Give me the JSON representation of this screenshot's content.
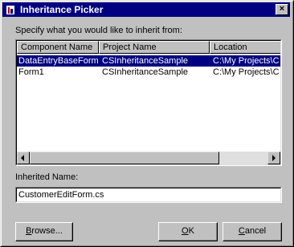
{
  "window": {
    "title": "Inheritance Picker",
    "close_glyph": "×",
    "icon": "app-icon"
  },
  "instruction": "Specify what you would like to inherit from:",
  "list": {
    "columns": [
      "Component Name",
      "Project Name",
      "Location"
    ],
    "rows": [
      {
        "component": "DataEntryBaseForm",
        "project": "CSInheritanceSample",
        "location": "C:\\My Projects\\C",
        "selected": true
      },
      {
        "component": "Form1",
        "project": "CSInheritanceSample",
        "location": "C:\\My Projects\\C",
        "selected": false
      }
    ],
    "scrollbar": {
      "left_icon": "scroll-left-arrow",
      "right_icon": "scroll-right-arrow"
    }
  },
  "inherited_name": {
    "label": "Inherited Name:",
    "value": "CustomerEditForm.cs"
  },
  "buttons": {
    "browse": {
      "label_ul": "B",
      "label_rest": "rowse..."
    },
    "ok": {
      "label_ul": "O",
      "label_rest": "K"
    },
    "cancel": {
      "label_ul": "C",
      "label_rest": "ancel"
    }
  },
  "colors": {
    "face": "#c0c0c0",
    "titlebar": "#000080",
    "selection": "#000080"
  }
}
